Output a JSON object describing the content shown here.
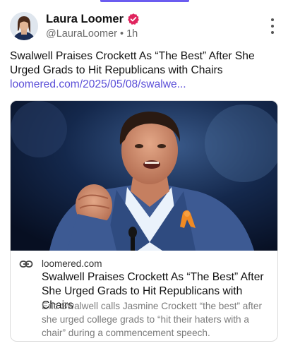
{
  "post": {
    "author_name": "Laura Loomer",
    "handle": "@LauraLoomer",
    "separator": "•",
    "time": "1h",
    "text": "Swalwell Praises Crockett As “The Best” After She Urged Grads to Hit Republicans with Chairs",
    "link": "loomered.com/2025/05/08/swalwe..."
  },
  "link_card": {
    "domain": "loomered.com",
    "title": "Swalwell Praises Crockett As “The Best” After She Urged Grads to Hit Republicans with Chairs",
    "description": "Eric Swalwell calls Jasmine Crockett “the best” after she urged college grads to “hit their haters with a chair” during a commencement speech."
  },
  "icons": {
    "verified": "verified-badge-icon",
    "more": "kebab-menu-icon",
    "link": "link-chain-icon"
  },
  "colors": {
    "accent": "#6b5cf0",
    "link": "#5b4fd8",
    "verified_badge": "#e0245e",
    "muted_text": "#6a6a6a"
  }
}
